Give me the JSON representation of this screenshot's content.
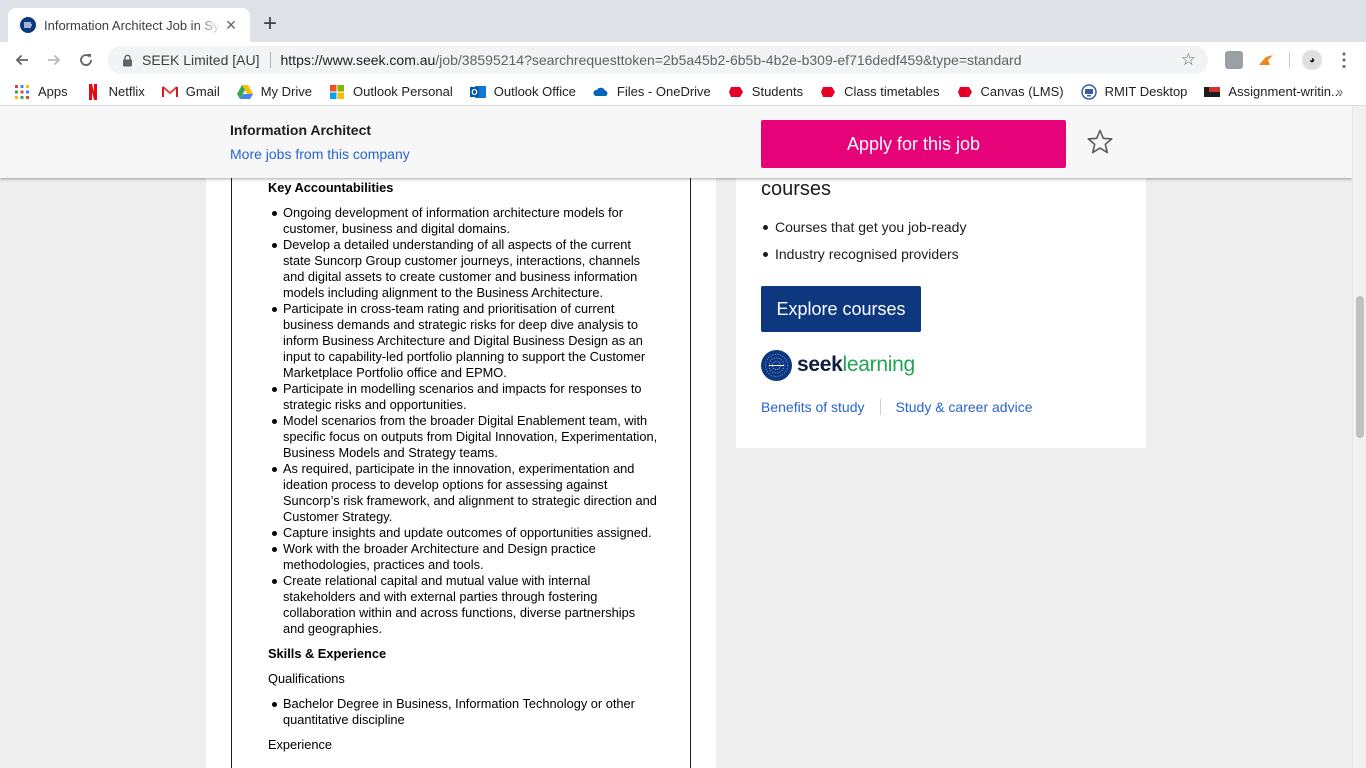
{
  "browser": {
    "tab": {
      "title": "Information Architect Job in Sydney"
    },
    "site_id": "SEEK Limited [AU]",
    "url_host": "https://www.seek.com.au",
    "url_path": "/job/38595214?searchrequesttoken=2b5a45b2-6b5b-4b2e-b309-ef716dedf459&type=standard",
    "bookmarks": [
      {
        "label": "Apps",
        "icon": "apps-grid-icon"
      },
      {
        "label": "Netflix",
        "icon": "netflix-icon"
      },
      {
        "label": "Gmail",
        "icon": "gmail-icon"
      },
      {
        "label": "My Drive",
        "icon": "drive-icon"
      },
      {
        "label": "Outlook Personal",
        "icon": "microsoft-icon"
      },
      {
        "label": "Outlook Office",
        "icon": "outlook-icon"
      },
      {
        "label": "Files - OneDrive",
        "icon": "onedrive-icon"
      },
      {
        "label": "Students",
        "icon": "rmit-icon"
      },
      {
        "label": "Class timetables",
        "icon": "rmit-icon"
      },
      {
        "label": "Canvas (LMS)",
        "icon": "rmit-icon"
      },
      {
        "label": "RMIT Desktop",
        "icon": "desktop-icon"
      },
      {
        "label": "Assignment-writin...",
        "icon": "flag-icon"
      }
    ],
    "more_bookmarks": "»"
  },
  "header": {
    "job_title": "Information Architect",
    "more_jobs_link": "More jobs from this company",
    "apply_label": "Apply for this job"
  },
  "ad": {
    "sections": [
      {
        "heading": "Key Accountabilities",
        "items": [
          "Ongoing development of information architecture models for customer, business and digital domains.",
          "Develop a detailed understanding of all aspects of the current state Suncorp Group customer journeys, interactions, channels and digital assets to create customer and business information models including alignment to the Business Architecture.",
          "Participate in cross-team rating and prioritisation of current business demands and strategic risks for deep dive analysis to inform Business Architecture and Digital Business Design as an input to capability-led portfolio planning to support the Customer Marketplace Portfolio office and EPMO.",
          "Participate in modelling scenarios and impacts for responses to strategic risks and opportunities.",
          "Model scenarios from the broader Digital Enablement team, with specific focus on outputs from Digital Innovation, Experimentation, Business Models and Strategy teams.",
          "As required, participate in the innovation, experimentation and ideation process to develop options for assessing against Suncorp’s risk framework, and alignment to strategic direction and Customer Strategy.",
          "Capture insights and update outcomes of opportunities assigned.",
          "Work with the broader Architecture and Design practice methodologies, practices and tools.",
          "Create relational capital and mutual value with internal stakeholders and with external parties through fostering collaboration within and across functions, diverse partnerships and geographies."
        ]
      },
      {
        "heading": "Skills & Experience"
      }
    ],
    "qualifications_label": "Qualifications",
    "qualifications": [
      "Bachelor Degree in Business, Information Technology or other quantitative discipline"
    ],
    "experience_label": "Experience"
  },
  "sidebar": {
    "heading": "courses",
    "bullets": [
      "Courses that get you job-ready",
      "Industry recognised providers"
    ],
    "explore_label": "Explore courses",
    "logo_seek": "seek",
    "logo_learning": "learning",
    "links": [
      "Benefits of study",
      "Study & career advice"
    ]
  }
}
